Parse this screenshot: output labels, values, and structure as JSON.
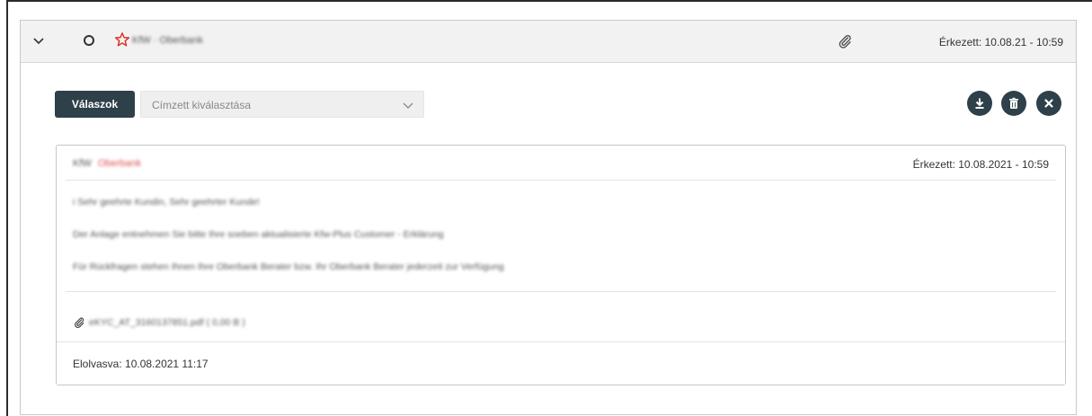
{
  "header": {
    "sender": "KfW · Oberbank",
    "arrived": "Érkezett: 10.08.21 - 10:59"
  },
  "toolbar": {
    "replies_label": "Válaszok",
    "recipient_placeholder": "Címzett kiválasztása"
  },
  "message": {
    "from_name": "KfW",
    "from_org": "Oberbank",
    "arrived": "Érkezett: 10.08.2021 - 10:59",
    "body_lines": [
      "i Sehr geehrte Kundin, Sehr geehrter Kunde!",
      "Der Anlage entnehmen Sie bitte Ihre soeben aktualisierte Kfw-Plus Customer - Erklärung",
      "Für Rückfragen stehen Ihnen Ihre Oberbank Berater bzw. Ihr Oberbank Berater jederzeit zur Verfügung"
    ],
    "attachment": "eKYC_AT_3160137851.pdf ( 0,00 B ) ",
    "read_at": "Elolvasva: 10.08.2021 11:17"
  },
  "colors": {
    "primary": "#2e4049",
    "star": "#d9342b",
    "org": "#d9534f"
  }
}
